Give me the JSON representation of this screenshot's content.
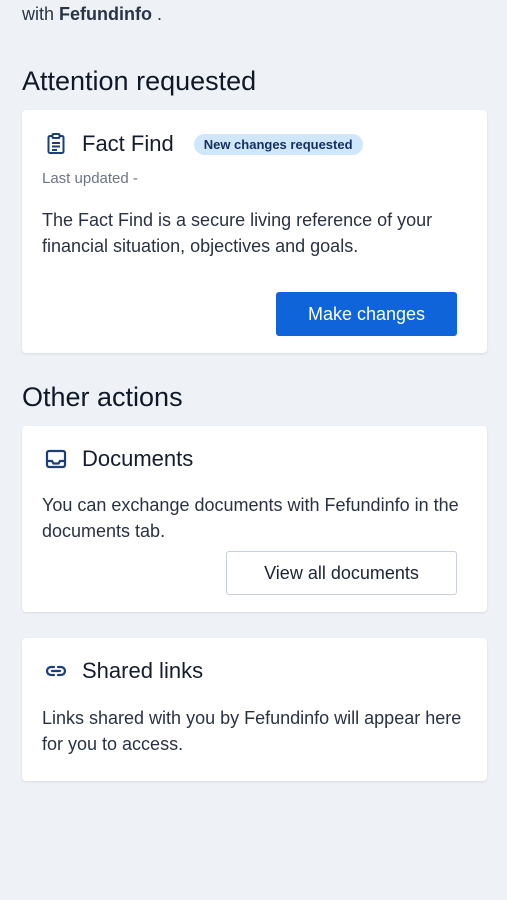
{
  "intro": {
    "prefix": "with ",
    "org": "Fefundinfo",
    "suffix": " ."
  },
  "attention": {
    "heading": "Attention requested",
    "card": {
      "icon": "clipboard-icon",
      "title": "Fact Find",
      "badge": "New changes requested",
      "last_updated": "Last updated -",
      "description": "The Fact Find is a secure living reference of your financial situation, objectives and goals.",
      "button": "Make changes"
    }
  },
  "other": {
    "heading": "Other actions",
    "documents": {
      "icon": "inbox-tray-icon",
      "title": "Documents",
      "description": "You can exchange documents with Fefundinfo in the documents tab.",
      "button": "View all documents"
    },
    "shared_links": {
      "icon": "link-icon",
      "title": "Shared links",
      "description": "Links shared with you by Fefundinfo will appear here for you to access."
    }
  },
  "colors": {
    "background": "#eef2f7",
    "primary": "#0e64d8",
    "badge_bg": "#cfe6fb",
    "icon": "#1d3f78"
  }
}
